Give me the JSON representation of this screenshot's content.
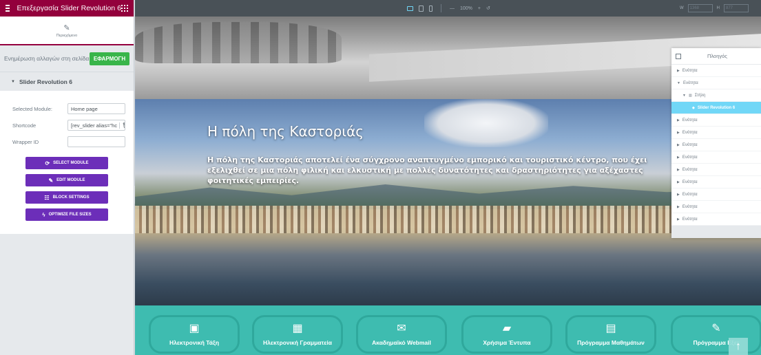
{
  "panel": {
    "title": "Επεξεργασία Slider Revolution 6",
    "tab_label": "Περιεχόμενο",
    "update_text": "Ενημέρωση αλλαγών στη σελίδα",
    "apply_label": "ΕΦΑΡΜΟΓΗ",
    "section_title": "Slider Revolution 6",
    "fields": [
      {
        "label": "Selected Module:",
        "value": "Home page"
      },
      {
        "label": "Shortcode",
        "value": "[rev_slider alias=\"hc"
      },
      {
        "label": "Wrapper ID",
        "value": ""
      }
    ],
    "buttons": [
      {
        "label": "SELECT MODULE",
        "icon": "refresh-icon"
      },
      {
        "label": "EDIT MODULE",
        "icon": "pencil-icon"
      },
      {
        "label": "BLOCK SETTINGS",
        "icon": "sliders-icon"
      },
      {
        "label": "OPTIMIZE FILE SIZES",
        "icon": "bolt-icon"
      }
    ]
  },
  "toolbar": {
    "zoom": "100%",
    "width_label": "W",
    "width_value": "1368",
    "height_label": "H",
    "height_value": "877"
  },
  "hero": {
    "title": "Η πόλη της Καστοριάς",
    "text": "Η πόλη της Καστοριάς αποτελεί ένα σύγχρονο αναπτυγμένο εμπορικό και τουριστικό κέντρο, που έχει εξελιχθεί σε μια πόλη φιλική και ελκυστική με πολλές δυνατότητες και δραστηριότητες για αξέχαστες φοιτητικές εμπειρίες."
  },
  "quick_links": [
    {
      "label": "Ηλεκτρονική Τάξη",
      "icon": "classroom-icon"
    },
    {
      "label": "Ηλεκτρονική Γραμματεία",
      "icon": "graduation-icon"
    },
    {
      "label": "Ακαδημαϊκό Webmail",
      "icon": "envelope-icon"
    },
    {
      "label": "Χρήσιμα Έντυπα",
      "icon": "folder-icon"
    },
    {
      "label": "Πρόγραμμα Μαθημάτων",
      "icon": "calendar-icon"
    },
    {
      "label": "Πρόγραμμα Εξετ",
      "icon": "pencil-icon"
    }
  ],
  "navigator": {
    "title": "Πλοηγός",
    "items": [
      {
        "label": "Ενότητα",
        "level": 1
      },
      {
        "label": "Ενότητα",
        "level": 1
      },
      {
        "label": "Στήλη",
        "level": 2
      },
      {
        "label": "Slider Revolution 6",
        "level": 3
      },
      {
        "label": "Ενότητα",
        "level": 1
      },
      {
        "label": "Ενότητα",
        "level": 1
      },
      {
        "label": "Ενότητα",
        "level": 1
      },
      {
        "label": "Ενότητα",
        "level": 1
      },
      {
        "label": "Ενότητα",
        "level": 1
      },
      {
        "label": "Ενότητα",
        "level": 1
      },
      {
        "label": "Ενότητα",
        "level": 1
      },
      {
        "label": "Ενότητα",
        "level": 1
      },
      {
        "label": "Ενότητα",
        "level": 1
      }
    ]
  },
  "colors": {
    "brand": "#93003c",
    "apply": "#39b54a",
    "button": "#6c2eb9",
    "teal": "#3ebcb0",
    "selected": "#71d7f7"
  }
}
